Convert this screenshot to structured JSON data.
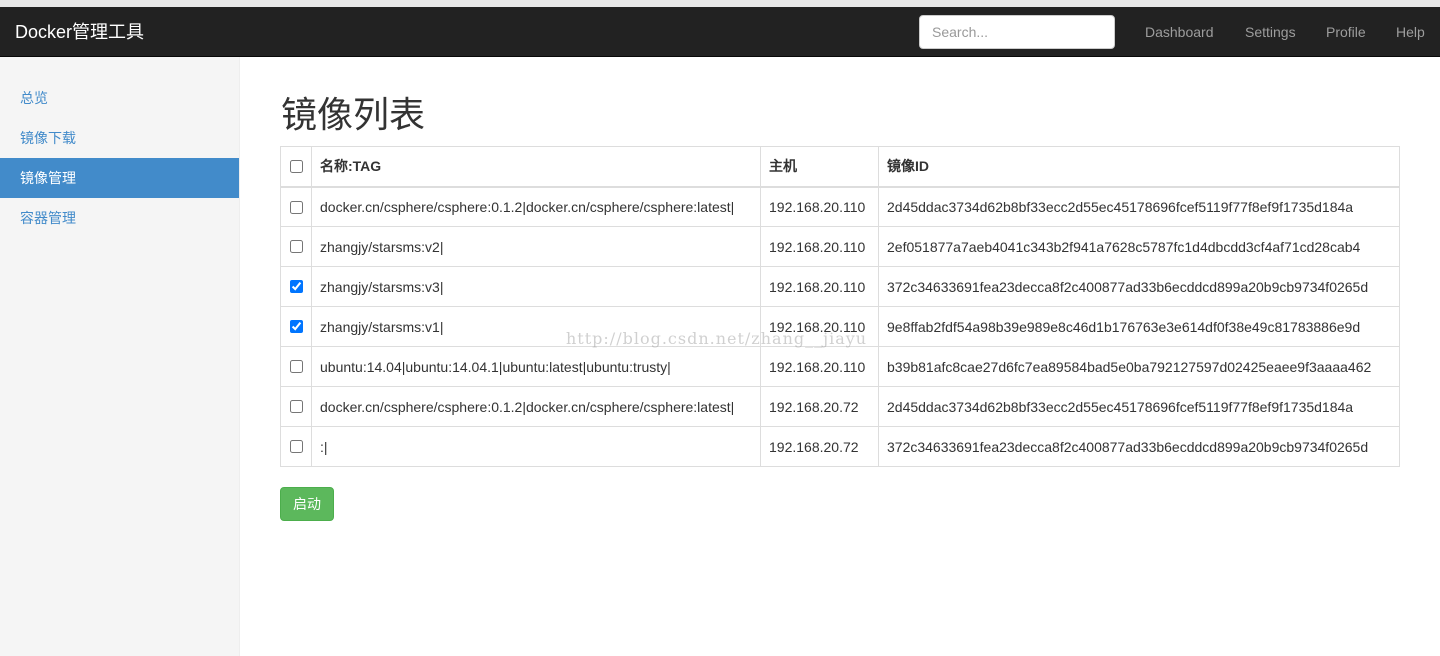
{
  "navbar": {
    "brand": "Docker管理工具",
    "search_placeholder": "Search...",
    "links": [
      "Dashboard",
      "Settings",
      "Profile",
      "Help"
    ]
  },
  "sidebar": {
    "items": [
      {
        "label": "总览",
        "active": false
      },
      {
        "label": "镜像下载",
        "active": false
      },
      {
        "label": "镜像管理",
        "active": true
      },
      {
        "label": "容器管理",
        "active": false
      }
    ]
  },
  "main": {
    "title": "镜像列表",
    "table": {
      "headers": [
        "名称:TAG",
        "主机",
        "镜像ID"
      ],
      "rows": [
        {
          "checked": false,
          "tag": "docker.cn/csphere/csphere:0.1.2|docker.cn/csphere/csphere:latest|",
          "host": "192.168.20.110",
          "id": "2d45ddac3734d62b8bf33ecc2d55ec45178696fcef5119f77f8ef9f1735d184a"
        },
        {
          "checked": false,
          "tag": "zhangjy/starsms:v2|",
          "host": "192.168.20.110",
          "id": "2ef051877a7aeb4041c343b2f941a7628c5787fc1d4dbcdd3cf4af71cd28cab4"
        },
        {
          "checked": true,
          "tag": "zhangjy/starsms:v3|",
          "host": "192.168.20.110",
          "id": "372c34633691fea23decca8f2c400877ad33b6ecddcd899a20b9cb9734f0265d"
        },
        {
          "checked": true,
          "tag": "zhangjy/starsms:v1|",
          "host": "192.168.20.110",
          "id": "9e8ffab2fdf54a98b39e989e8c46d1b176763e3e614df0f38e49c81783886e9d"
        },
        {
          "checked": false,
          "tag": "ubuntu:14.04|ubuntu:14.04.1|ubuntu:latest|ubuntu:trusty|",
          "host": "192.168.20.110",
          "id": "b39b81afc8cae27d6fc7ea89584bad5e0ba792127597d02425eaee9f3aaaa462"
        },
        {
          "checked": false,
          "tag": "docker.cn/csphere/csphere:0.1.2|docker.cn/csphere/csphere:latest|",
          "host": "192.168.20.72",
          "id": "2d45ddac3734d62b8bf33ecc2d55ec45178696fcef5119f77f8ef9f1735d184a"
        },
        {
          "checked": false,
          "tag": ":|",
          "host": "192.168.20.72",
          "id": "372c34633691fea23decca8f2c400877ad33b6ecddcd899a20b9cb9734f0265d"
        }
      ]
    },
    "start_button": "启动"
  },
  "watermark": "http://blog.csdn.net/zhang__jiayu"
}
